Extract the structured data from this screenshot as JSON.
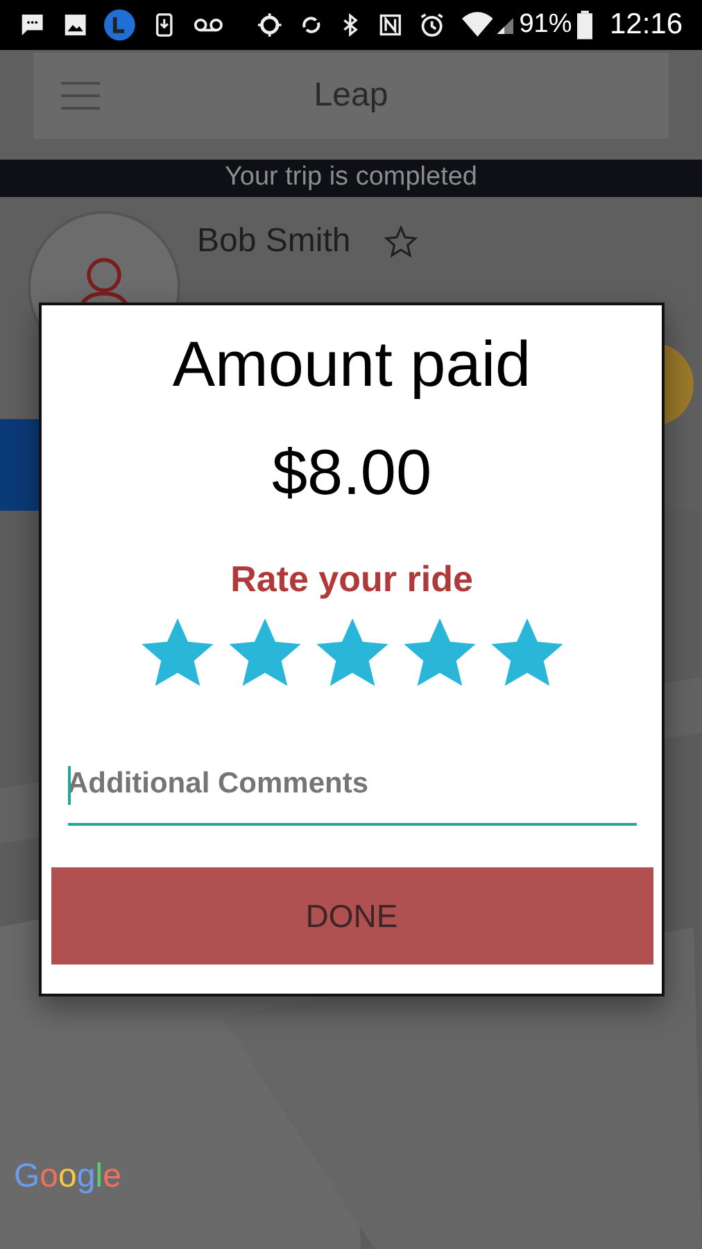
{
  "status_bar": {
    "battery": "91%",
    "time": "12:16"
  },
  "app_bar": {
    "title": "Leap"
  },
  "banner": "Your trip is completed",
  "driver": {
    "name": "Bob Smith",
    "favorite": false
  },
  "dialog": {
    "title": "Amount paid",
    "amount": "$8.00",
    "rate_label": "Rate your ride",
    "stars": 5,
    "comments": {
      "placeholder": "Additional Comments",
      "focused": true
    },
    "button": "DONE"
  },
  "map": {
    "logo": "Google"
  }
}
